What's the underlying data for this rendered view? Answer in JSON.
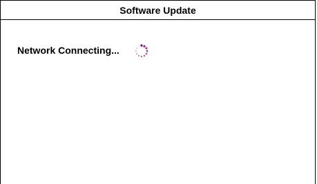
{
  "dialog": {
    "title": "Software Update",
    "status_text": "Network Connecting...",
    "spinner_icon": "loading-spinner-icon",
    "spinner_color": "#8b1a7a"
  }
}
